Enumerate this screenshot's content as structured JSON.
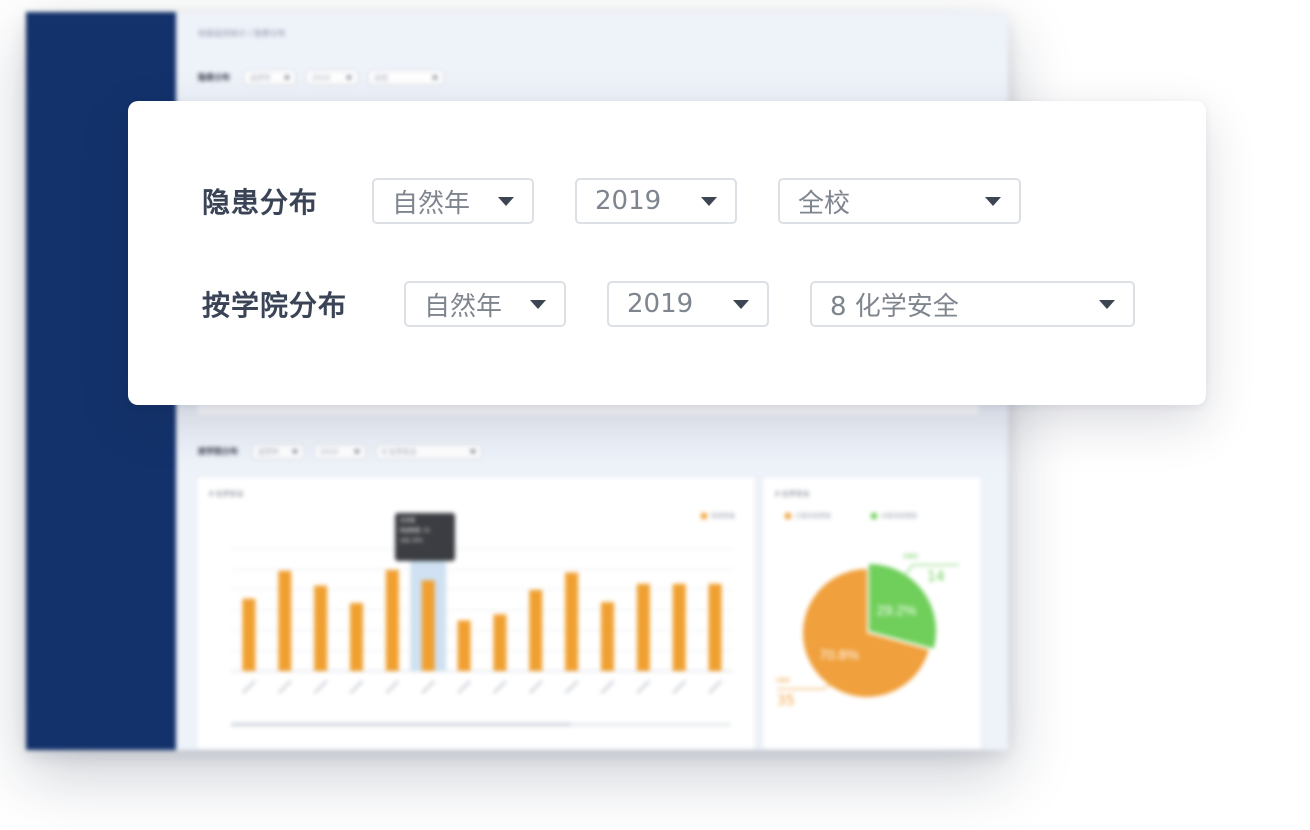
{
  "background": {
    "breadcrumb": "校级监控统计 / 隐患分布",
    "top_filter": {
      "label": "隐患分布",
      "period": "自然年",
      "year": "2019",
      "scope": "全校"
    },
    "college_filter": {
      "label": "按学院分布",
      "period": "自然年",
      "year": "2019",
      "scope": "8 化学安全"
    },
    "bar_card": {
      "title": "8 化学安全",
      "legend": "隐患数量",
      "tooltip": {
        "title": "化学楼",
        "line1": "隐患数量: 10",
        "line2": "占比 10%"
      },
      "highlight_index": 5,
      "chart_data": {
        "type": "bar",
        "categories": [
          "",
          "",
          "",
          "",
          "",
          "",
          "",
          "",
          "",
          "",
          "",
          "",
          "",
          ""
        ],
        "values": [
          8.3,
          11.5,
          9.8,
          7.8,
          11.6,
          10.4,
          5.8,
          6.5,
          9.3,
          11.3,
          7.9,
          10.0,
          10.0,
          10.0
        ],
        "ylim": [
          0,
          14
        ],
        "color": "#f0a030",
        "highlight_color": "#cfe1f2"
      }
    },
    "pie_card": {
      "title": "8 化学安全",
      "legend": [
        {
          "label": "已整改隐患数",
          "color": "#f0a03c"
        },
        {
          "label": "未整改隐患数",
          "color": "#6fcf5a"
        }
      ],
      "callout_top": {
        "label": "未整改",
        "value": "14"
      },
      "callout_bottom": {
        "label": "已整改",
        "value": "35"
      },
      "chart_data": {
        "type": "pie",
        "slices": [
          {
            "label": "70.8%",
            "value": 70.8,
            "color": "#f0a03c"
          },
          {
            "label": "29.2%",
            "value": 29.2,
            "color": "#6fcf5a"
          }
        ]
      }
    }
  },
  "focus_card": {
    "rows": [
      {
        "label": "隐患分布",
        "period": "自然年",
        "year": "2019",
        "scope": "全校"
      },
      {
        "label": "按学院分布",
        "period": "自然年",
        "year": "2019",
        "scope": "8 化学安全"
      }
    ]
  }
}
